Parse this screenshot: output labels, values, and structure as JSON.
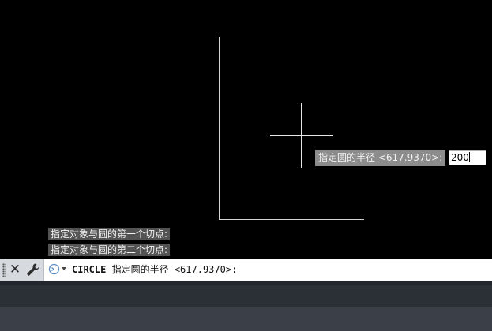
{
  "canvas": {
    "background": "#000000"
  },
  "dynamic_input": {
    "prompt": "指定圆的半径 <617.9370>:",
    "value": "200"
  },
  "command_history": [
    "指定对象与圆的第一个切点:",
    "指定对象与圆的第二个切点:"
  ],
  "command_line": {
    "command": "CIRCLE",
    "prompt": "指定圆的半径 <617.9370>:",
    "close_icon": "close-icon",
    "customize_icon": "wrench-icon",
    "prompt_icon": "command-prompt-icon"
  },
  "colors": {
    "canvas": "#000000",
    "geometry": "#d4d4d4",
    "command_bar": "#ffffff",
    "status_bar": "#2b2f36"
  }
}
